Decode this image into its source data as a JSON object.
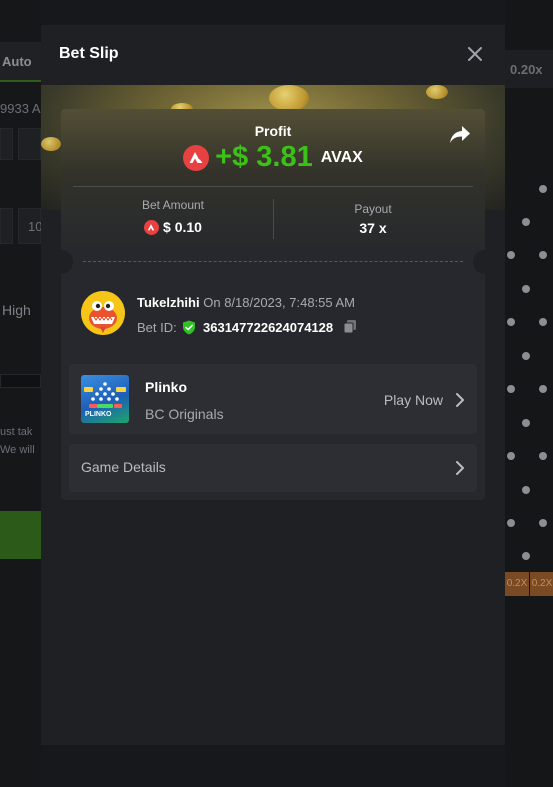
{
  "background": {
    "tab_label": "Auto",
    "fragment_1": "9933 A",
    "fragment_2": "10",
    "fragment_3": "High",
    "fragment_4": "ust tak",
    "fragment_5": "We will",
    "top_multiplier": "0.20x",
    "bucket_labels": [
      "0.2X",
      "0.2X"
    ]
  },
  "modal": {
    "title": "Bet Slip"
  },
  "profit": {
    "label": "Profit",
    "amount": "+$ 3.81",
    "currency": "AVAX"
  },
  "bet": {
    "amount_label": "Bet Amount",
    "amount_value": "$ 0.10",
    "payout_label": "Payout",
    "payout_value": "37 x"
  },
  "player": {
    "name": "Tukelzhihi",
    "date": "On 8/18/2023, 7:48:55 AM",
    "bet_id_label": "Bet ID:",
    "bet_id": "363147722624074128"
  },
  "game": {
    "name": "Plinko",
    "provider": "BC Originals",
    "play_label": "Play Now",
    "thumb_text": "PLINKO"
  },
  "details": {
    "label": "Game Details"
  },
  "colors": {
    "profit_green": "#3bc117",
    "avax_red": "#e84142",
    "modal_bg": "#1e2024",
    "card_bg": "#26282d"
  },
  "icons": {
    "close": "close-icon",
    "share": "share-icon",
    "currency": "avax-icon",
    "verified": "shield-check-icon",
    "copy": "copy-icon",
    "chevron": "chevron-right-icon"
  }
}
